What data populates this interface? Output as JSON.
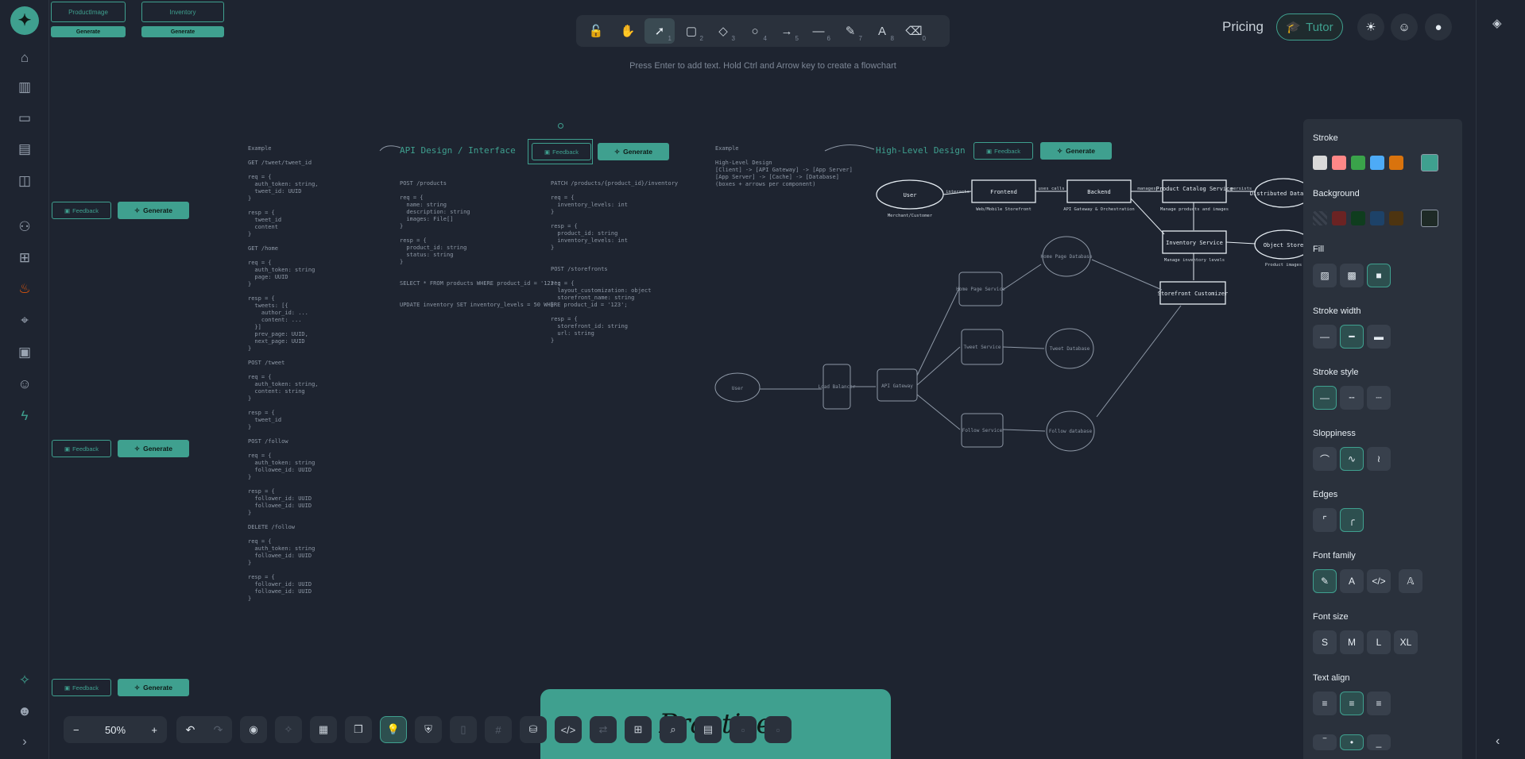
{
  "toolbar": {
    "tools": [
      {
        "icon": "lock-icon",
        "glyph": "🔓",
        "num": ""
      },
      {
        "icon": "hand-icon",
        "glyph": "✋",
        "num": ""
      },
      {
        "icon": "pointer-icon",
        "glyph": "➚",
        "num": "1"
      },
      {
        "icon": "rectangle-icon",
        "glyph": "▢",
        "num": "2"
      },
      {
        "icon": "diamond-icon",
        "glyph": "◇",
        "num": "3"
      },
      {
        "icon": "ellipse-icon",
        "glyph": "○",
        "num": "4"
      },
      {
        "icon": "arrow-icon",
        "glyph": "→",
        "num": "5"
      },
      {
        "icon": "line-icon",
        "glyph": "—",
        "num": "6"
      },
      {
        "icon": "pencil-icon",
        "glyph": "✎",
        "num": "7"
      },
      {
        "icon": "text-icon",
        "glyph": "A",
        "num": "8"
      },
      {
        "icon": "eraser-icon",
        "glyph": "⌫",
        "num": "0"
      }
    ],
    "hint": "Press Enter to add text. Hold Ctrl and Arrow key to create a flowchart"
  },
  "topright": {
    "pricing": "Pricing",
    "tutor": "Tutor"
  },
  "canvas": {
    "top_tags": [
      "ProductImage",
      "Inventory",
      "Generate",
      "Generate"
    ],
    "feedback_label": "Feedback",
    "generate_label": "Generate",
    "api_heading": "API Design / Interface",
    "hld_heading": "High-Level Design",
    "example1": "Example\n\nGET /tweet/tweet_id\n\nreq = {\n  auth_token: string,\n  tweet_id: UUID\n}\n\nresp = {\n  tweet_id\n  content\n}\n\nGET /home\n\nreq = {\n  auth_token: string\n  page: UUID\n}\n\nresp = {\n  tweets: [{\n    author_id: ...\n    content: ...\n  }]\n  prev_page: UUID,\n  next_page: UUID\n}\n\nPOST /tweet\n\nreq = {\n  auth_token: string,\n  content: string\n}\n\nresp = {\n  tweet_id\n}\n\nPOST /follow\n\nreq = {\n  auth_token: string\n  followee_id: UUID\n}\n\nresp = {\n  follower_id: UUID\n  followee_id: UUID\n}\n\nDELETE /follow\n\nreq = {\n  auth_token: string\n  followee_id: UUID\n}\n\nresp = {\n  follower_id: UUID\n  followee_id: UUID\n}",
    "post_products": "POST /products\n\nreq = {\n  name: string\n  description: string\n  images: File[]\n}\n\nresp = {\n  product_id: string\n  status: string\n}\n\n\nSELECT * FROM products WHERE product_id = '123';\n\n\nUPDATE inventory SET inventory_levels = 50 WHERE product_id = '123';",
    "patch_inventory": "PATCH /products/{product_id}/inventory\n\nreq = {\n  inventory_levels: int\n}\n\nresp = {\n  product_id: string\n  inventory_levels: int\n}\n\n\nPOST /storefronts\n\nreq = {\n  layout_customization: object\n  storefront_name: string\n}\n\nresp = {\n  storefront_id: string\n  url: string\n}",
    "example2": "Example\n\nHigh-Level Design\n[Client] -> [API Gateway] -> [App Server]\n[App Server] -> [Cache] -> [Database]\n(boxes + arrows per component)",
    "hld_nodes": [
      "User",
      "Frontend",
      "Backend",
      "Product Catalog Service",
      "Distributed Database",
      "Inventory Service",
      "Object Store",
      "Storefront Customizer",
      "User",
      "Load Balancer",
      "API Gateway",
      "Home Page Service",
      "Tweet Service",
      "Follow Service",
      "Home Page Database",
      "Tweet Database",
      "Follow database"
    ],
    "hld_labels": [
      "interacts",
      "uses calls",
      "manages",
      "persists",
      "Merchant/Customer",
      "Web/Mobile Storefront",
      "API Gateway & Orchestration",
      "Manage products and images",
      "Manage inventory levels",
      "Product images"
    ]
  },
  "props": {
    "stroke": "Stroke",
    "background": "Background",
    "fill": "Fill",
    "stroke_width": "Stroke width",
    "stroke_style": "Stroke style",
    "sloppiness": "Sloppiness",
    "edges": "Edges",
    "font_family": "Font family",
    "font_size": "Font size",
    "font_sizes": [
      "S",
      "M",
      "L",
      "XL"
    ],
    "text_align": "Text align",
    "stroke_colors": [
      "#d9d9d9",
      "#ff8787",
      "#3aa34a",
      "#4dabf7",
      "#d9730d",
      "#3fa08f"
    ],
    "bg_colors": [
      "#2a313c",
      "#6b2323",
      "#0f3d1e",
      "#1d4268",
      "#4d3410",
      "#1e2a26"
    ]
  },
  "bottom": {
    "zoom": "50%",
    "zoom_out": "−",
    "zoom_in": "+",
    "practice": "Practice"
  }
}
